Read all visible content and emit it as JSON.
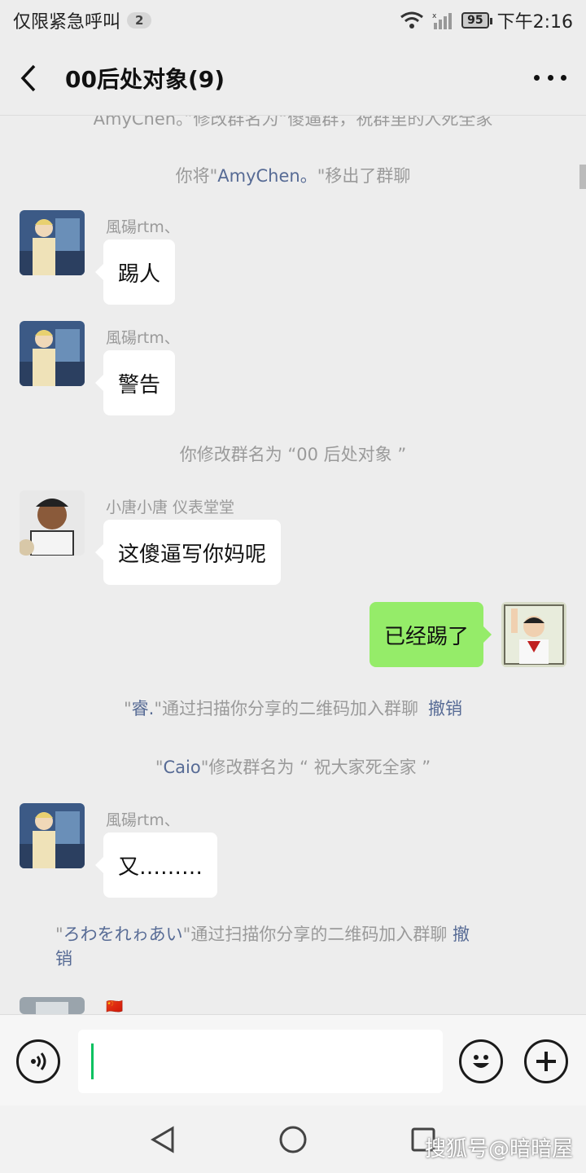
{
  "status_bar": {
    "carrier_text": "仅限紧急呼叫",
    "notification_count": "2",
    "battery": "95",
    "time": "下午2:16"
  },
  "nav": {
    "title": "00后处对象(9)"
  },
  "chat": {
    "partial_top_text": "AmyChen。”修改群名为“傻逼群，祝群里的人死全家",
    "sys1_prefix": "你将\"",
    "sys1_name": "AmyChen。",
    "sys1_suffix": "\"移出了群聊",
    "msg1": {
      "sender": "風碭rtm、",
      "text": "踢人"
    },
    "msg2": {
      "sender": "風碭rtm、",
      "text": "警告"
    },
    "sys2": "你修改群名为 “00 后处对象 ”",
    "msg3": {
      "sender": "小唐小唐 仪表堂堂",
      "text": "这傻逼写你妈呢"
    },
    "msg4": {
      "text": "已经踢了"
    },
    "sys3_prefix": "\"",
    "sys3_name": "睿.",
    "sys3_suffix": "\"通过扫描你分享的二维码加入群聊",
    "sys3_action": "撤销",
    "sys4_prefix": "\"",
    "sys4_name": "Caio",
    "sys4_suffix": "\"修改群名为 “ 祝大家死全家 ”",
    "msg5": {
      "sender": "風碭rtm、",
      "text": "又………"
    },
    "sys5_prefix": "\"",
    "sys5_name": "ろわをれゎあい",
    "sys5_suffix": "\"通过扫描你分享的二维码加入群聊",
    "sys5_action_1": "撤",
    "sys5_action_2": "销",
    "msg6_flag": "🇨🇳"
  },
  "input": {
    "value": ""
  },
  "watermark": "搜狐号@暗暗屋",
  "colors": {
    "link": "#576b95",
    "bubble_self": "#95ec69",
    "caret": "#07c160"
  }
}
